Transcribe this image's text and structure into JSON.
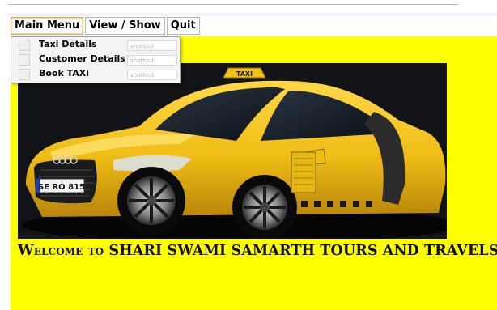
{
  "menubar": {
    "main_menu": "Main Menu",
    "view_show": "View / Show",
    "quit": "Quit"
  },
  "dropdown": {
    "items": [
      {
        "label": "Taxi Details",
        "shortcut_placeholder": "shortcut"
      },
      {
        "label": "Customer Details",
        "shortcut_placeholder": "shortcut"
      },
      {
        "label": "Book TAXi",
        "shortcut_placeholder": "shortcut"
      }
    ]
  },
  "banner": {
    "image_icon": "yellow-taxi-car-image",
    "taxi_roof_sign": "TAXI",
    "license_plate": "SE RO 815",
    "welcome_text": "Welcome to SHARI SWAMI SAMARTH TOURS AND TRAVELS"
  },
  "colors": {
    "background": "#ffff00",
    "car_body": "#f2c21a",
    "menu_active_border": "#e8a54c"
  }
}
